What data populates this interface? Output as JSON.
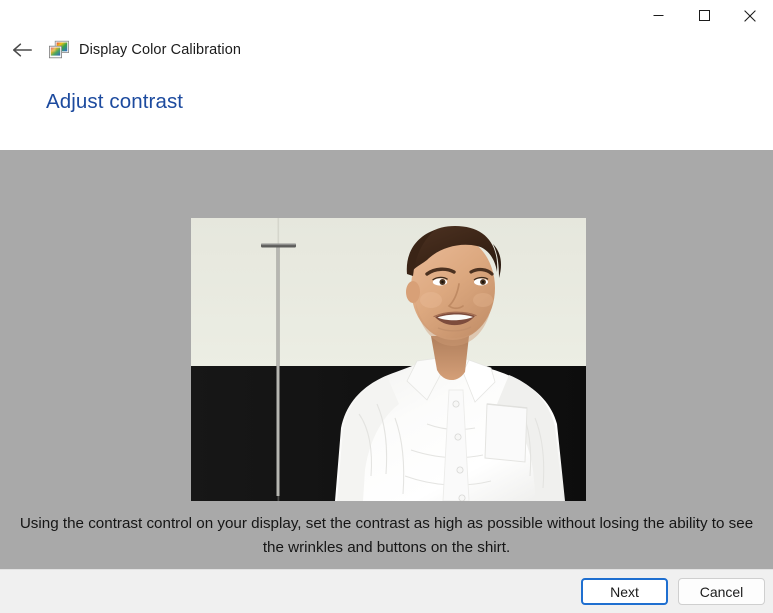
{
  "window": {
    "app_title": "Display Color Calibration",
    "app_icon": "display-color-calibration-icon",
    "back_icon": "back-arrow-icon",
    "controls": {
      "minimize": "minimize-icon",
      "maximize": "maximize-icon",
      "close": "close-icon"
    }
  },
  "page": {
    "heading": "Adjust contrast",
    "caption": "Using the contrast control on your display, set the contrast as high as possible without losing the ability to see the wrinkles and buttons on the shirt.",
    "sample_image": {
      "name": "contrast-sample-photo",
      "description": "Man in a white dress shirt standing in front of a cream wall with a black lower panel and a thin floor lamp pole"
    }
  },
  "footer": {
    "next_label": "Next",
    "cancel_label": "Cancel"
  },
  "colors": {
    "heading": "#1c4a9e",
    "stage_background": "#a9a9a9",
    "footer_background": "#f0f0f0",
    "default_button_border": "#1f6fd0",
    "window_background": "#ffffff"
  }
}
